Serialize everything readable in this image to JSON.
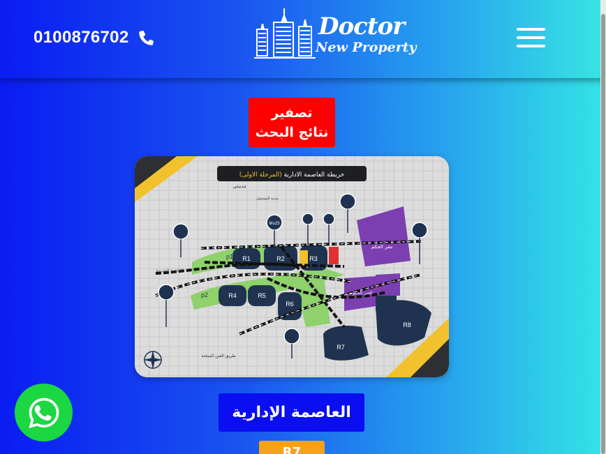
{
  "header": {
    "phone_number": "0100876702",
    "logo": {
      "line1": "Doctor",
      "line2": "New Property"
    },
    "menu_icon": "hamburger-icon",
    "phone_icon": "phone-icon"
  },
  "filters": {
    "reset_label": "تصفير نتائج البحث"
  },
  "map_image": {
    "title": "خريطة العاصمة الادارية",
    "title_highlight": "(المرحلة الاولى)",
    "zones": [
      "R1",
      "R2",
      "R3",
      "R4",
      "R5",
      "R6",
      "R7",
      "R8",
      "p1",
      "p2",
      "Mu23"
    ],
    "labels": {
      "gov_seat": "مقر الحكم",
      "gov_district": "الحي الحكومي",
      "madinaty": "مدينتي",
      "mostaqbal": "مدينة المستقبل",
      "new_cairo": "القاهرة الجديدة",
      "ain_sokhna": "طريق العين السخنة"
    }
  },
  "listing": {
    "category_label": "العاصمة الإدارية",
    "tag_label": "R7"
  },
  "whatsapp": {
    "icon": "whatsapp-icon"
  },
  "colors": {
    "header_gradient_start": "#0a1cf2",
    "header_gradient_end": "#38e6e3",
    "reset_button": "#ff0000",
    "category_button": "#0a0ef0",
    "tag_button": "#f7a11a",
    "whatsapp": "#1bd741"
  }
}
